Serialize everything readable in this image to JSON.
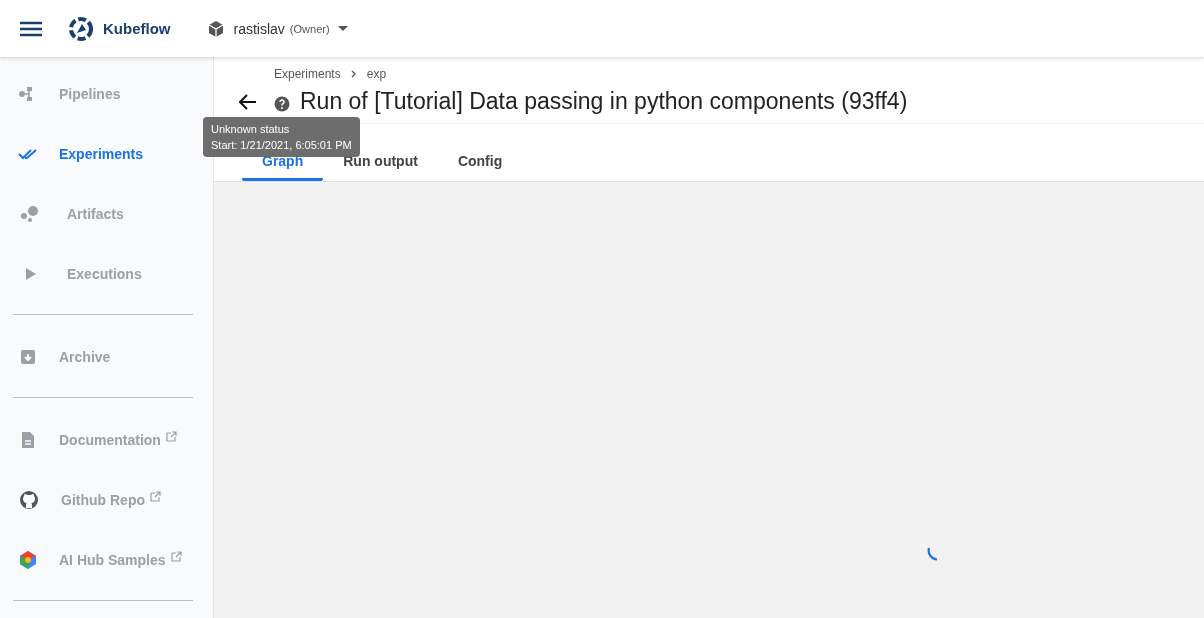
{
  "header": {
    "brand": "Kubeflow",
    "namespace": "rastislav",
    "role": "(Owner)"
  },
  "sidebar": {
    "groups": [
      {
        "items": [
          {
            "kind": "pipelines",
            "label": "Pipelines",
            "selected": false,
            "external": false
          },
          {
            "kind": "experiments",
            "label": "Experiments",
            "selected": true,
            "external": false
          },
          {
            "kind": "artifacts",
            "label": "Artifacts",
            "selected": false,
            "external": false
          },
          {
            "kind": "executions",
            "label": "Executions",
            "selected": false,
            "external": false
          }
        ]
      },
      {
        "items": [
          {
            "kind": "archive",
            "label": "Archive",
            "selected": false,
            "external": false
          }
        ]
      },
      {
        "items": [
          {
            "kind": "documentation",
            "label": "Documentation",
            "selected": false,
            "external": true
          },
          {
            "kind": "github",
            "label": "Github Repo",
            "selected": false,
            "external": true
          },
          {
            "kind": "aihub",
            "label": "AI Hub Samples",
            "selected": false,
            "external": true
          }
        ]
      }
    ]
  },
  "breadcrumbs": [
    "Experiments",
    "exp"
  ],
  "title": "Run of [Tutorial] Data passing in python components (93ff4)",
  "tooltip": [
    "Unknown status",
    "Start: 1/21/2021, 6:05:01 PM"
  ],
  "tabs": [
    {
      "label": "Graph",
      "selected": true
    },
    {
      "label": "Run output",
      "selected": false
    },
    {
      "label": "Config",
      "selected": false
    }
  ],
  "loading": true
}
